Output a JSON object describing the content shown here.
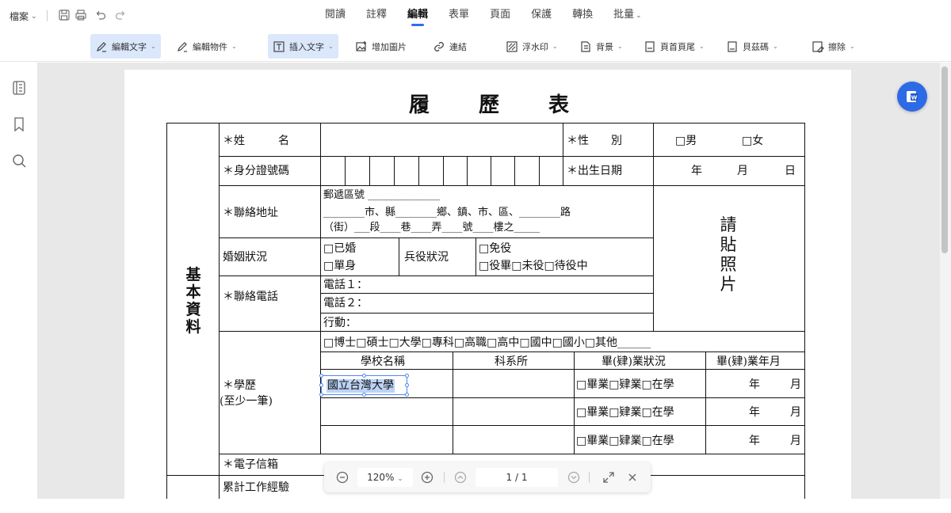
{
  "menubar": {
    "file_label": "檔案",
    "tabs": [
      {
        "label": "閱讀"
      },
      {
        "label": "註釋"
      },
      {
        "label": "編輯"
      },
      {
        "label": "表單"
      },
      {
        "label": "頁面"
      },
      {
        "label": "保護"
      },
      {
        "label": "轉換"
      },
      {
        "label": "批量"
      }
    ],
    "active_tab": "編輯"
  },
  "toolbar": {
    "edit_text": "編輯文字",
    "edit_object": "編輯物件",
    "insert_text": "插入文字",
    "add_image": "增加圖片",
    "link": "連結",
    "watermark": "浮水印",
    "background": "背景",
    "header_footer": "頁首頁尾",
    "bates": "貝茲碼",
    "erase": "擦除"
  },
  "document": {
    "title": "履歷表",
    "section_label": "基本資料",
    "name_label": "＊姓　　　名",
    "gender_label": "＊性　　別",
    "gender_male": "□男",
    "gender_female": "□女",
    "id_label": "＊身分證號碼",
    "birth_label": "＊出生日期",
    "birth_year": "年",
    "birth_month": "月",
    "birth_day": "日",
    "address_label": "＊聯絡地址",
    "address_line1": "郵遞區號 ______________",
    "address_line2": "________市、縣________鄉、鎮、市、區、________路",
    "address_line3": "（街）___段____巷____弄____號____樓之_____",
    "photo_text": "請貼照片",
    "marital_label": "婚姻狀況",
    "marital_opt1": "□已婚",
    "marital_opt2": "□單身",
    "military_label": "兵役狀況",
    "military_opt1": "□免役",
    "military_opt2": "□役畢□未役□待役中",
    "phone_label": "＊聯絡電話",
    "phone1": "電話１：",
    "phone2": "電話２：",
    "mobile": "行動：",
    "degree_options": "□博士□碩士□大學□專科□高職□高中□國中□國小□其他______",
    "edu_label": "＊學歷",
    "edu_note": "(至少一筆)",
    "col_school": "學校名稱",
    "col_dept": "科系所",
    "col_status": "畢(肄)業狀況",
    "col_date": "畢(肄)業年月",
    "school_value": "國立台灣大學",
    "grad_status": "□畢業□肄業□在學",
    "grad_year": "年",
    "grad_month": "月",
    "email_label": "＊電子信箱",
    "work_label": "累計工作經驗"
  },
  "zoombar": {
    "zoom_value": "120%",
    "page_value": "1 / 1"
  }
}
